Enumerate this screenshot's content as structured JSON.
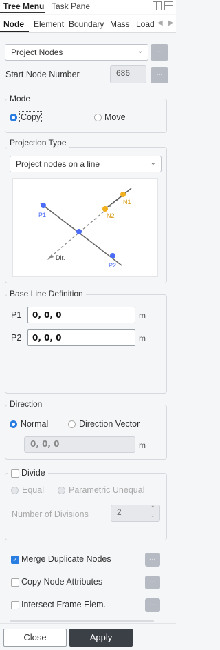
{
  "panel_tabs": {
    "tree_menu": "Tree Menu",
    "task_pane": "Task Pane"
  },
  "sub_tabs": [
    "Node",
    "Element",
    "Boundary",
    "Mass",
    "Load"
  ],
  "command": {
    "selected": "Project Nodes",
    "more_label": "..."
  },
  "start_node": {
    "label": "Start Node Number",
    "value": "686"
  },
  "mode": {
    "title": "Mode",
    "options": [
      {
        "label": "Copy",
        "selected": true
      },
      {
        "label": "Move",
        "selected": false
      }
    ]
  },
  "projection": {
    "title": "Projection Type",
    "selected": "Project nodes on a line",
    "diagram_labels": {
      "p1": "P1",
      "p2": "P2",
      "n1": "N1",
      "n2": "N2",
      "dir": "Dir."
    },
    "colors": {
      "points": "#4a6cf7",
      "nodes": "#f2b01e"
    }
  },
  "base_line": {
    "title": "Base Line Definition",
    "p1_label": "P1",
    "p1_value": "0, 0, 0",
    "p2_label": "P2",
    "p2_value": "0, 0, 0",
    "unit": "m"
  },
  "direction": {
    "title": "Direction",
    "options": [
      {
        "label": "Normal",
        "selected": true
      },
      {
        "label": "Direction Vector",
        "selected": false
      }
    ],
    "vector_value": "0, 0, 0",
    "unit": "m"
  },
  "divide": {
    "label": "Divide",
    "checked": false,
    "options": [
      {
        "label": "Equal",
        "selected": true
      },
      {
        "label": "Parametric Unequal",
        "selected": false
      }
    ],
    "num_label": "Number of Divisions",
    "num_value": "2"
  },
  "options": [
    {
      "label": "Merge Duplicate Nodes",
      "checked": true
    },
    {
      "label": "Copy Node Attributes",
      "checked": false
    },
    {
      "label": "Intersect Frame Elem.",
      "checked": false
    }
  ],
  "actions": {
    "close": "Close",
    "apply": "Apply"
  },
  "accent_color": "#2a7de1"
}
